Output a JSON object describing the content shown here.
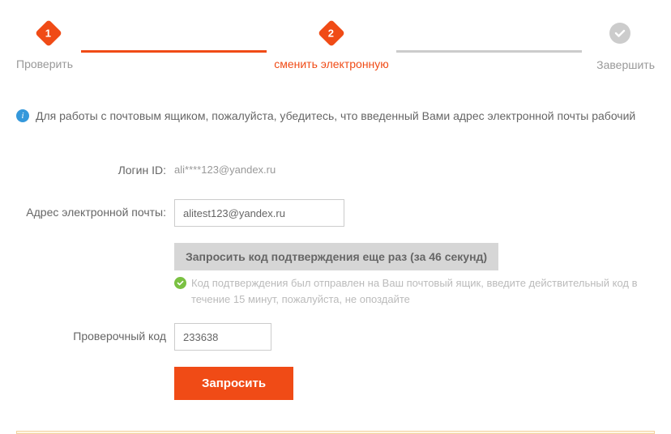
{
  "stepper": {
    "step1": {
      "num": "1",
      "label": "Проверить"
    },
    "step2": {
      "num": "2",
      "label": "сменить электронную"
    },
    "step3": {
      "label": "Завершить"
    }
  },
  "notice": {
    "text": "Для работы с почтовым ящиком, пожалуйста, убедитесь, что введенный Вами адрес электронной почты рабочий"
  },
  "form": {
    "login": {
      "label": "Логин ID:",
      "value": "ali****123@yandex.ru"
    },
    "email": {
      "label": "Адрес электронной почты:",
      "value": "alitest123@yandex.ru"
    },
    "resend_btn": "Запросить код подтверждения еще раз (за 46 секунд)",
    "sent_text": "Код подтверждения был отправлен на Ваш почтовый ящик, введите действительный код в течение 15 минут, пожалуйста, не опоздайте",
    "code": {
      "label": "Проверочный код",
      "value": "233638"
    },
    "submit": "Запросить"
  }
}
